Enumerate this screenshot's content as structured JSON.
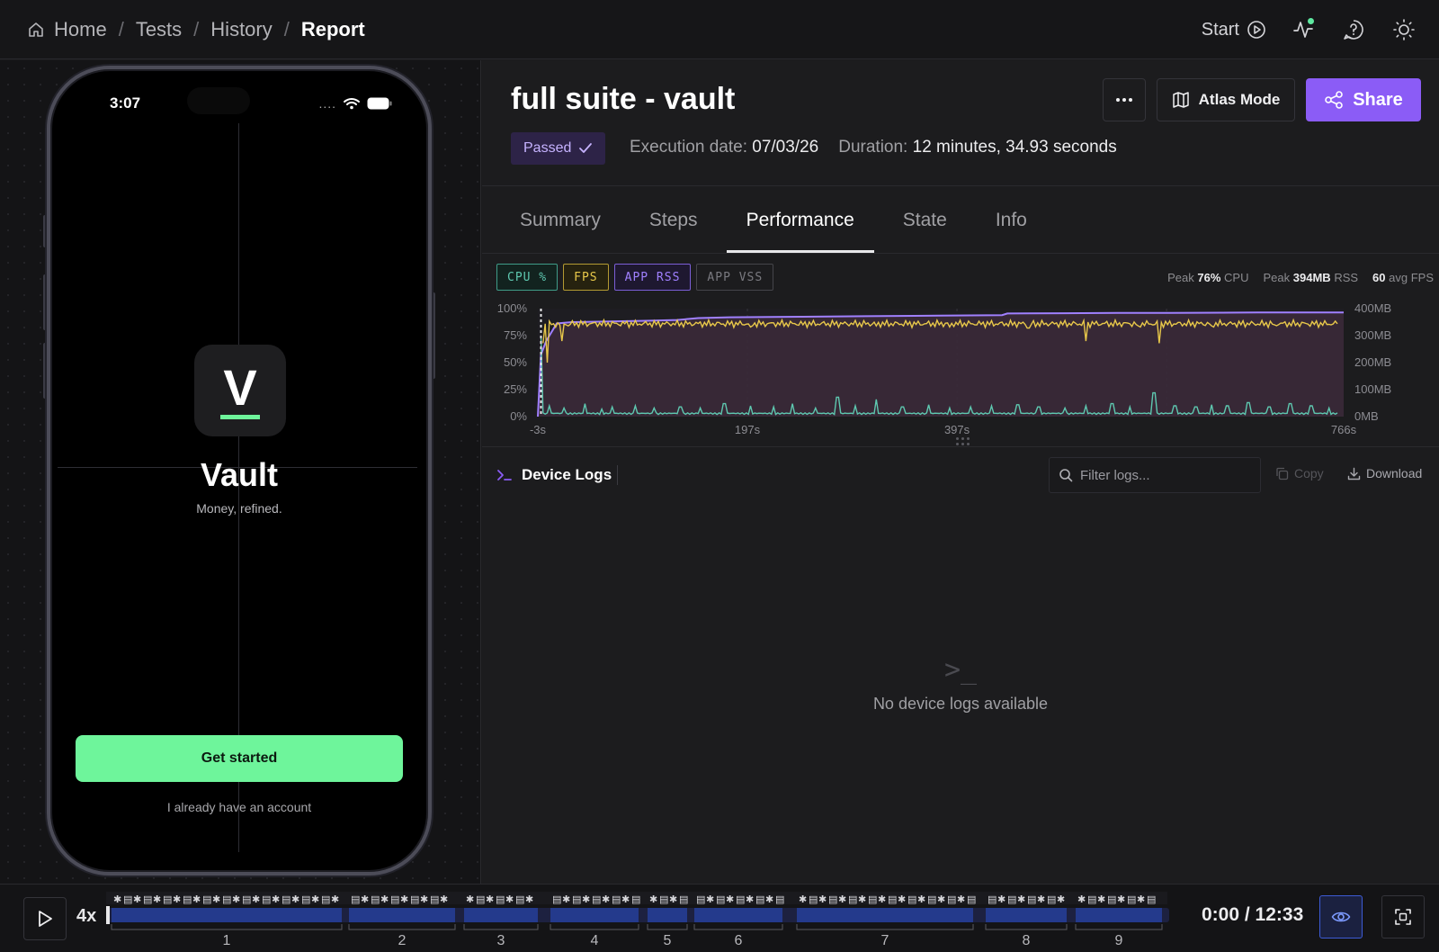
{
  "breadcrumb": {
    "items": [
      "Home",
      "Tests",
      "History"
    ],
    "current": "Report"
  },
  "topbar": {
    "start_label": "Start",
    "icons": [
      "activity-icon",
      "help-chat-icon",
      "theme-sun-icon"
    ]
  },
  "device": {
    "time": "3:07",
    "signal": "....",
    "app": {
      "logo_letter": "V",
      "name": "Vault",
      "tagline": "Money, refined.",
      "primary_button": "Get started",
      "secondary_link": "I already have an account",
      "accent": "#6ef59b"
    }
  },
  "report": {
    "title": "full suite - vault",
    "status": "Passed",
    "execution_label": "Execution date:",
    "execution_date": "07/03/26",
    "duration_label": "Duration:",
    "duration": "12 minutes, 34.93 seconds",
    "more_label": "…",
    "atlas_label": "Atlas Mode",
    "share_label": "Share"
  },
  "tabs": [
    {
      "label": "Summary",
      "active": false
    },
    {
      "label": "Steps",
      "active": false
    },
    {
      "label": "Performance",
      "active": true
    },
    {
      "label": "State",
      "active": false
    },
    {
      "label": "Info",
      "active": false
    }
  ],
  "performance": {
    "legend": [
      {
        "label": "CPU %",
        "color": "#5ec8b0"
      },
      {
        "label": "FPS",
        "color": "#e8c84a"
      },
      {
        "label": "APP RSS",
        "color": "#a080ff"
      },
      {
        "label": "APP VSS",
        "color": "#8a8a90"
      }
    ],
    "peak_prefix": "Peak",
    "peak_cpu": "76%",
    "peak_cpu_unit": "CPU",
    "peak_rss": "394MB",
    "peak_rss_unit": "RSS",
    "avg_fps": "60",
    "avg_fps_unit": "avg FPS"
  },
  "chart_data": {
    "type": "line",
    "x_ticks": [
      "-3s",
      "197s",
      "397s",
      "766s"
    ],
    "y_left_ticks": [
      "100%",
      "75%",
      "50%",
      "25%",
      "0%"
    ],
    "y_right_ticks": [
      "400MB",
      "300MB",
      "200MB",
      "100MB",
      "0MB"
    ],
    "xlim": [
      -3,
      766
    ],
    "ylim_left": [
      0,
      100
    ],
    "ylim_right": [
      0,
      400
    ],
    "series": [
      {
        "name": "CPU %",
        "color": "#5ec8b0",
        "baseline": 2,
        "x": [
          0,
          8,
          22,
          42,
          58,
          68,
          90,
          108,
          133,
          152,
          175,
          200,
          222,
          240,
          262,
          283,
          300,
          320,
          345,
          370,
          390,
          410,
          430,
          455,
          475,
          500,
          520,
          545,
          562,
          585,
          605,
          625,
          640,
          655,
          675,
          695,
          715,
          735,
          752
        ],
        "y": [
          75,
          10,
          8,
          12,
          7,
          9,
          10,
          8,
          9,
          8,
          12,
          10,
          9,
          12,
          8,
          18,
          10,
          16,
          9,
          11,
          8,
          9,
          10,
          11,
          9,
          8,
          10,
          12,
          9,
          22,
          10,
          9,
          11,
          10,
          13,
          9,
          12,
          10,
          8
        ]
      },
      {
        "name": "FPS",
        "color": "#e8c84a",
        "baseline": 86,
        "x": [
          2,
          6,
          12,
          20,
          26,
          80,
          200,
          250,
          320,
          390,
          465,
          520,
          570,
          590,
          640,
          700,
          760
        ],
        "y": [
          68,
          50,
          86,
          70,
          84,
          86,
          83,
          85,
          84,
          83,
          82,
          70,
          84,
          68,
          84,
          85,
          86
        ]
      },
      {
        "name": "APP RSS",
        "color": "#a080ff",
        "x": [
          -3,
          0,
          5,
          15,
          30,
          60,
          100,
          130,
          150,
          180,
          250,
          310,
          380,
          440,
          445,
          500,
          550,
          600,
          650,
          700,
          766
        ],
        "y": [
          0,
          230,
          280,
          345,
          350,
          352,
          355,
          358,
          365,
          368,
          370,
          372,
          374,
          376,
          382,
          383,
          384,
          384,
          385,
          386,
          386
        ]
      }
    ]
  },
  "logs": {
    "title": "Device Logs",
    "filter_placeholder": "Filter logs...",
    "copy_label": "Copy",
    "download_label": "Download",
    "empty_icon": ">_",
    "empty_text": "No device logs available"
  },
  "playback": {
    "speed": "4x",
    "time": "0:00 / 12:33",
    "segments": [
      "1",
      "2",
      "3",
      "4",
      "5",
      "6",
      "7",
      "8",
      "9"
    ]
  }
}
